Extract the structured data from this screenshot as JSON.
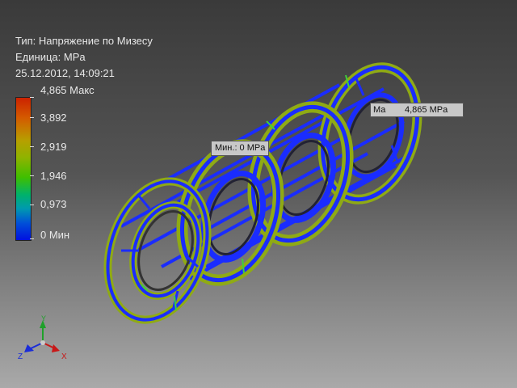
{
  "result": {
    "type_line": "Тип: Напряжение по Мизесу",
    "unit_line": "Единица: MPa",
    "timestamp": "25.12.2012, 14:09:21"
  },
  "legend": {
    "max_label": "4,865 Макс",
    "values": [
      "3,892",
      "2,919",
      "1,946",
      "0,973"
    ],
    "min_label": "0 Мин",
    "colors": {
      "max": "#cc2200",
      "mid": "#8fb300",
      "min": "#0010e0"
    }
  },
  "callouts": {
    "min": "Мин.: 0 MPa",
    "max": "4,865 MPa",
    "max_prefix": "Ма"
  },
  "triad": {
    "x": "X",
    "y": "Y",
    "z": "Z"
  }
}
